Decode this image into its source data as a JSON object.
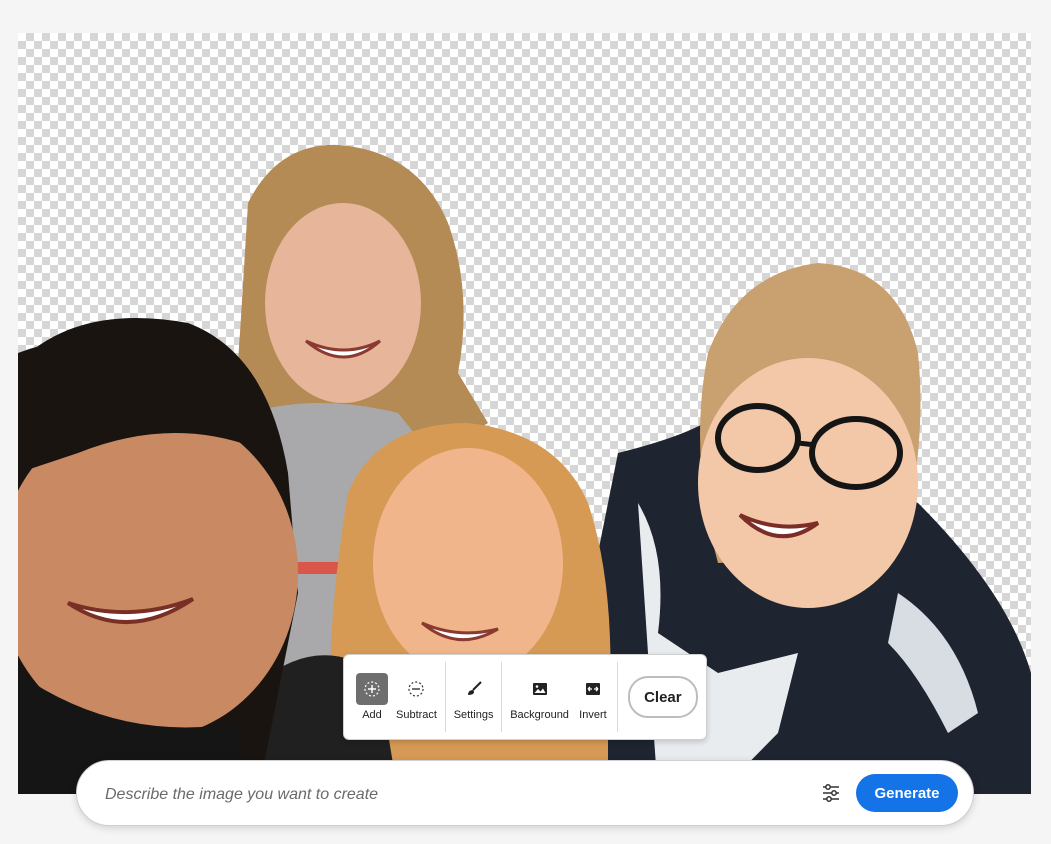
{
  "toolbar": {
    "tools": [
      {
        "label": "Add",
        "icon": "add-selection-icon",
        "active": true
      },
      {
        "label": "Subtract",
        "icon": "subtract-selection-icon",
        "active": false
      },
      {
        "label": "Settings",
        "icon": "brush-icon",
        "active": false
      },
      {
        "label": "Background",
        "icon": "image-icon",
        "active": false
      },
      {
        "label": "Invert",
        "icon": "invert-icon",
        "active": false
      }
    ],
    "clear_label": "Clear"
  },
  "prompt": {
    "placeholder": "Describe the image you want to create",
    "value": "",
    "settings_icon": "sliders-icon",
    "generate_label": "Generate"
  },
  "colors": {
    "accent": "#1473e6",
    "active_tool": "#6e6e6e"
  }
}
